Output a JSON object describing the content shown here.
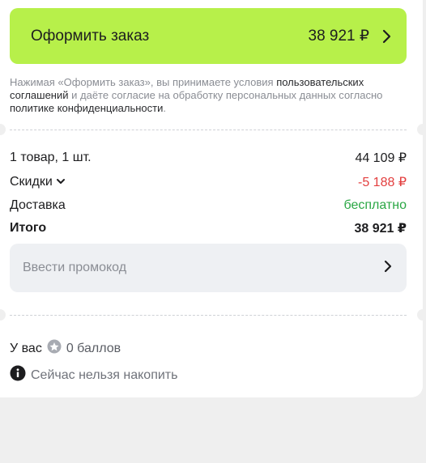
{
  "checkout": {
    "label": "Оформить заказ",
    "price": "38 921 ₽"
  },
  "legal": {
    "part1": "Нажимая «Оформить заказ», вы принимаете условия ",
    "link1": "пользовательских соглашений",
    "part2": " и даёте согласие на обработку персональных данных согласно ",
    "link2": "политике конфиденциальности",
    "part3": "."
  },
  "summary": {
    "items_label": "1 товар, 1 шт.",
    "items_value": "44 109 ₽",
    "discount_label": "Скидки",
    "discount_value": "-5 188 ₽",
    "delivery_label": "Доставка",
    "delivery_value": "бесплатно",
    "total_label": "Итого",
    "total_value": "38 921 ₽"
  },
  "promo": {
    "placeholder": "Ввести промокод"
  },
  "points": {
    "prefix": "У вас",
    "count": "0 баллов",
    "hint": "Сейчас нельзя накопить"
  },
  "colors": {
    "accent": "#b7f04a",
    "discount": "#e33f3f",
    "delivery": "#2aa744"
  },
  "icons": {
    "checkout_arrow": "chevron-right-icon",
    "discount_toggle": "chevron-down-icon",
    "promo_arrow": "chevron-right-icon",
    "points_coin": "coin-icon",
    "info": "info-icon"
  }
}
